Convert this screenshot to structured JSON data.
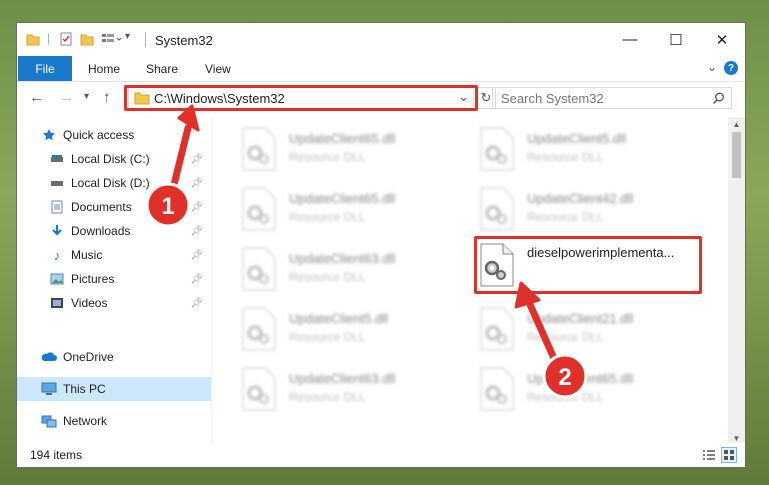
{
  "window": {
    "title": "System32",
    "controls": {
      "minimize": "—",
      "maximize": "☐",
      "close": "✕"
    }
  },
  "ribbon": {
    "tabs": [
      "File",
      "Home",
      "Share",
      "View"
    ],
    "help": "?"
  },
  "nav": {
    "address": "C:\\Windows\\System32",
    "search_placeholder": "Search System32"
  },
  "sidebar": {
    "items": [
      {
        "label": "Quick access",
        "icon": "star-icon",
        "pinned": false
      },
      {
        "label": "Local Disk (C:)",
        "icon": "drive-icon",
        "pinned": true
      },
      {
        "label": "Local Disk (D:)",
        "icon": "drive-icon",
        "pinned": true
      },
      {
        "label": "Documents",
        "icon": "documents-icon",
        "pinned": true
      },
      {
        "label": "Downloads",
        "icon": "downloads-icon",
        "pinned": true
      },
      {
        "label": "Music",
        "icon": "music-icon",
        "pinned": true
      },
      {
        "label": "Pictures",
        "icon": "pictures-icon",
        "pinned": true
      },
      {
        "label": "Videos",
        "icon": "videos-icon",
        "pinned": true
      },
      {
        "label": "OneDrive",
        "icon": "cloud-icon",
        "pinned": false
      },
      {
        "label": "This PC",
        "icon": "computer-icon",
        "pinned": false,
        "selected": true
      },
      {
        "label": "Network",
        "icon": "network-icon",
        "pinned": false
      }
    ]
  },
  "files": {
    "left": [
      {
        "name": "UpdateClient65.dll",
        "type": "Resource DLL"
      },
      {
        "name": "UpdateClient65.dll",
        "type": "Resource DLL"
      },
      {
        "name": "UpdateClient63.dll",
        "type": "Resource DLL"
      },
      {
        "name": "UpdateClient5.dll",
        "type": "Resource DLL"
      },
      {
        "name": "UpdateClient63.dll",
        "type": "Resource DLL"
      }
    ],
    "right": [
      {
        "name": "UpdateClient5.dll",
        "type": "Resource DLL"
      },
      {
        "name": "UpdateClient42.dll",
        "type": "Resource DLL"
      },
      {
        "name": "dieselpowerimplementa...",
        "type": "",
        "highlighted": true
      },
      {
        "name": "UpdateClient21.dll",
        "type": "Resource DLL"
      },
      {
        "name": "UpdateClient65.dll",
        "type": "Resource DLL"
      }
    ]
  },
  "status": {
    "count": "194 items"
  },
  "annotations": [
    {
      "number": "1"
    },
    {
      "number": "2"
    }
  ],
  "colors": {
    "accent": "#1979ca",
    "highlight": "#e0302a",
    "selected": "#cce8ff"
  }
}
